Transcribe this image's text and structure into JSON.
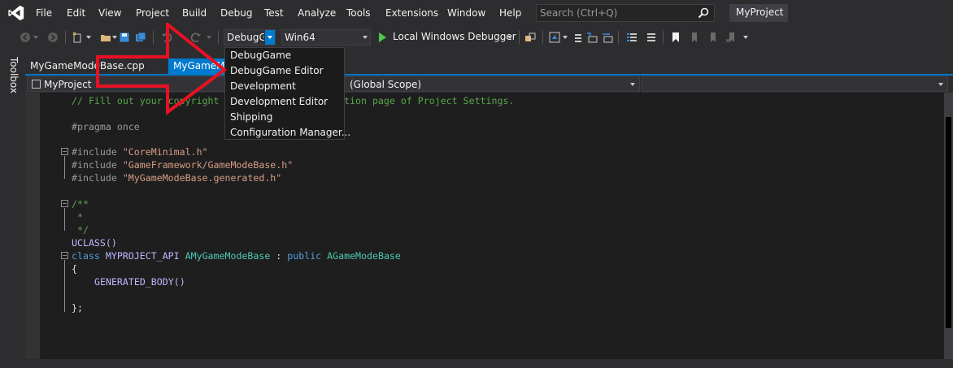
{
  "menubar": {
    "items": [
      "File",
      "Edit",
      "View",
      "Project",
      "Build",
      "Debug",
      "Test",
      "Analyze",
      "Tools",
      "Extensions",
      "Window",
      "Help"
    ],
    "search_placeholder": "Search (Ctrl+Q)",
    "project_name": "MyProject"
  },
  "toolbar": {
    "config_value": "DebugGame",
    "platform_value": "Win64",
    "run_label": "Local Windows Debugger"
  },
  "toolbox": {
    "label": "Toolbox"
  },
  "tabs": [
    {
      "label": "MyGameModeBase.cpp"
    },
    {
      "label": "MyGameModeBase.h"
    }
  ],
  "navbar": {
    "project": "MyProject",
    "scope": "(Global Scope)",
    "member": ""
  },
  "dropdown": {
    "items": [
      "DebugGame",
      "DebugGame Editor",
      "Development",
      "Development Editor",
      "Shipping",
      "Configuration Manager..."
    ]
  },
  "code": {
    "line1": "// Fill out your copyright notice in the Description page of Project Settings.",
    "line2_kw": "#pragma",
    "line2_rest": " once",
    "inc_kw": "#include",
    "inc1": "\"CoreMinimal.h\"",
    "inc2": "\"GameFramework/GameModeBase.h\"",
    "inc3": "\"MyGameModeBase.generated.h\"",
    "c1": "/**",
    "c2": " *",
    "c3": " */",
    "uclass": "UCLASS()",
    "class_kw": "class",
    "api": "MYPROJECT_API",
    "class_name": "AMyGameModeBase",
    "colon": " : ",
    "public_kw": "public",
    "base": "AGameModeBase",
    "open_brace": "{",
    "gen_body": "GENERATED_BODY()",
    "close_brace": "};"
  },
  "colors": {
    "accent": "#007acc",
    "annotation": "#e81123"
  }
}
